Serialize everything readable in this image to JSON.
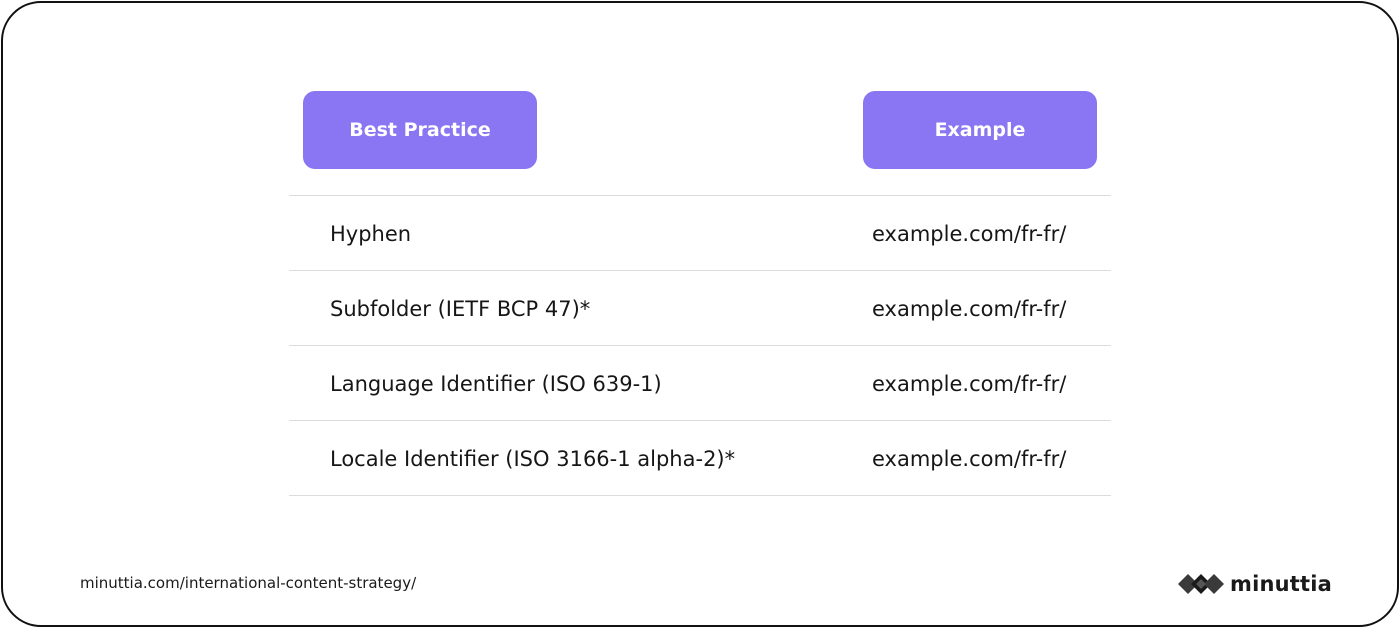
{
  "table": {
    "headers": {
      "best_practice": "Best Practice",
      "example": "Example"
    },
    "rows": [
      {
        "practice": "Hyphen",
        "example": "example.com/fr-fr/"
      },
      {
        "practice": "Subfolder (IETF BCP 47)*",
        "example": "example.com/fr-fr/"
      },
      {
        "practice": "Language Identifier (ISO 639-1)",
        "example": "example.com/fr-fr/"
      },
      {
        "practice": "Locale Identifier (ISO 3166-1 alpha-2)*",
        "example": "example.com/fr-fr/"
      }
    ]
  },
  "footer": {
    "url": "minuttia.com/international-content-strategy/",
    "brand": "minuttia",
    "logo_icon": "diamond-cluster-icon"
  },
  "colors": {
    "accent": "#8a76f2",
    "border": "#111111",
    "divider": "#dcdcdc"
  }
}
